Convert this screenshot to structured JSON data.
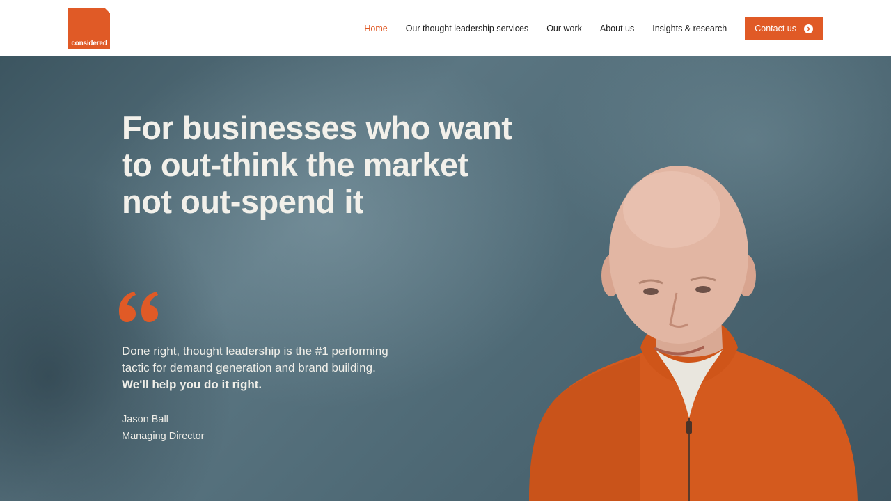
{
  "header": {
    "logo_text": "considered",
    "nav": [
      {
        "label": "Home",
        "active": true
      },
      {
        "label": "Our thought leadership services",
        "active": false
      },
      {
        "label": "Our work",
        "active": false
      },
      {
        "label": "About us",
        "active": false
      },
      {
        "label": "Insights & research",
        "active": false
      }
    ],
    "contact_label": "Contact us"
  },
  "hero": {
    "headline_lines": [
      "For businesses who want",
      "to out-think the market",
      "not out-spend it"
    ],
    "quote_lines": [
      "Done right, thought leadership is the #1 performing",
      "tactic for demand generation and brand building."
    ],
    "quote_emphasis": "We'll help you do it right.",
    "person_name": "Jason Ball",
    "person_title": "Managing Director"
  },
  "colors": {
    "accent": "#e05a26",
    "nav_text": "#1b1b1b",
    "hero_text": "#f2f0ea",
    "hero_bg": "#4f6a76"
  },
  "icons": {
    "contact": "arrow-circle-right-icon",
    "quote": "quote-mark-icon"
  }
}
